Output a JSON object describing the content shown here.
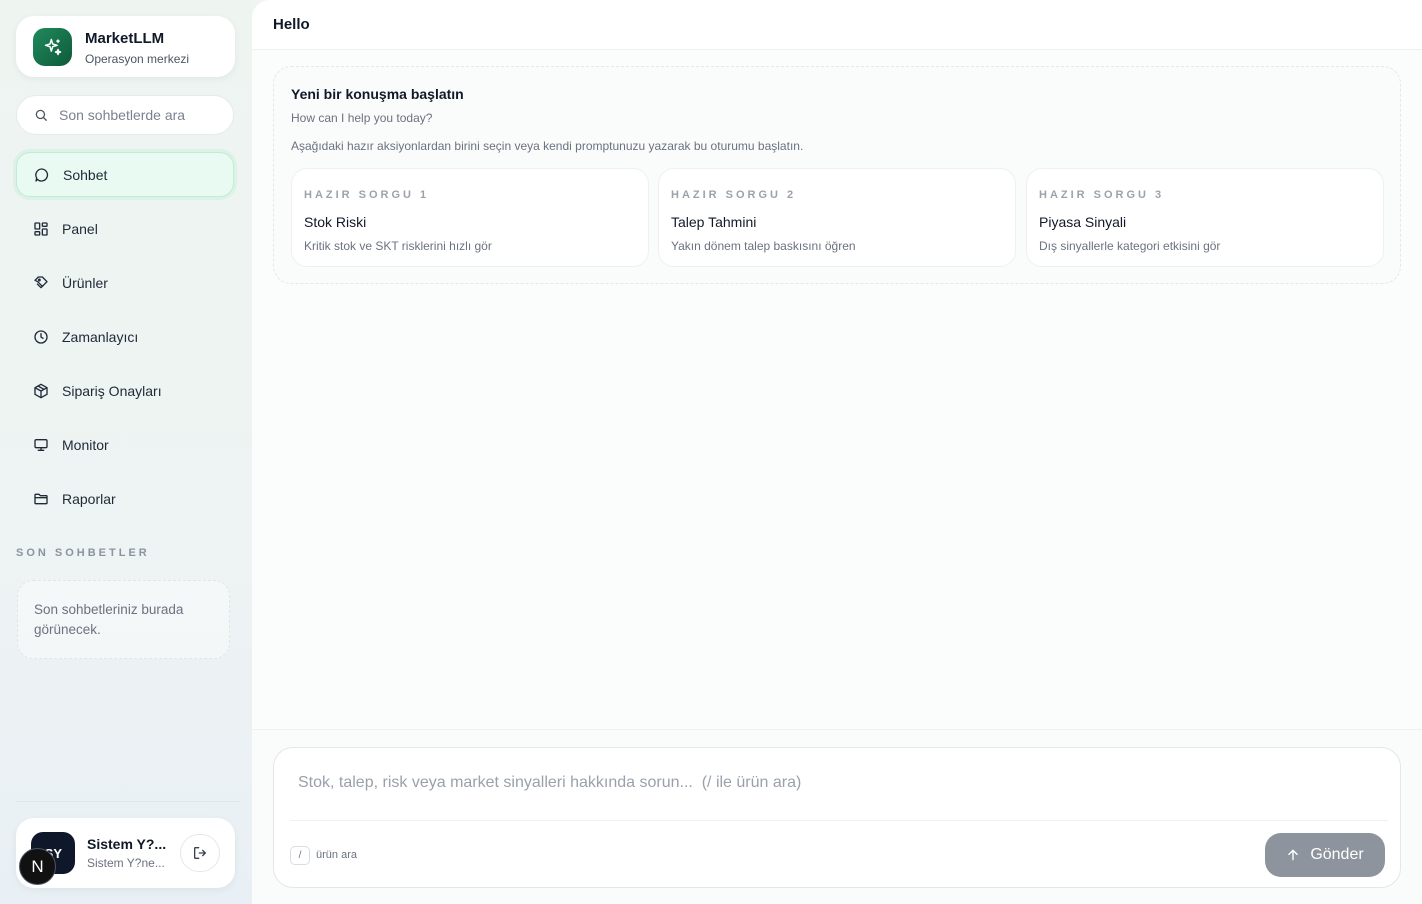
{
  "brand": {
    "name": "MarketLLM",
    "subtitle": "Operasyon merkezi",
    "logo_icon": "sparkles-icon",
    "accent": "#1f8a5c"
  },
  "search": {
    "placeholder": "Son sohbetlerde ara",
    "icon": "search-icon"
  },
  "nav": [
    {
      "label": "Sohbet",
      "icon": "chat-icon",
      "active": true
    },
    {
      "label": "Panel",
      "icon": "grid-icon",
      "active": false
    },
    {
      "label": "Ürünler",
      "icon": "tag-icon",
      "active": false
    },
    {
      "label": "Zamanlayıcı",
      "icon": "clock-icon",
      "active": false
    },
    {
      "label": "Sipariş Onayları",
      "icon": "package-icon",
      "active": false
    },
    {
      "label": "Monitor",
      "icon": "monitor-icon",
      "active": false
    },
    {
      "label": "Raporlar",
      "icon": "folder-icon",
      "active": false
    }
  ],
  "recent": {
    "title": "SON SOHBETLER",
    "empty_text": "Son sohbetleriniz burada görünecek."
  },
  "user": {
    "initials": "SY",
    "name": "Sistem Y?...",
    "subtitle": "Sistem Y?ne...",
    "logout_icon": "logout-icon",
    "badge_letter": "N"
  },
  "header": {
    "title": "Hello"
  },
  "welcome": {
    "title": "Yeni bir konuşma başlatın",
    "subtitle": "How can I help you today?",
    "description": "Aşağıdaki hazır aksiyonlardan birini seçin veya kendi promptunuzu yazarak bu oturumu başlatın.",
    "cards": [
      {
        "kicker": "HAZIR SORGU 1",
        "title": "Stok Riski",
        "desc": "Kritik stok ve SKT risklerini hızlı gör"
      },
      {
        "kicker": "HAZIR SORGU 2",
        "title": "Talep Tahmini",
        "desc": "Yakın dönem talep baskısını öğren"
      },
      {
        "kicker": "HAZIR SORGU 3",
        "title": "Piyasa Sinyali",
        "desc": "Dış sinyallerle kategori etkisini gör"
      }
    ]
  },
  "composer": {
    "placeholder": "Stok, talep, risk veya market sinyalleri hakkında sorun...  (/ ile ürün ara)",
    "slash_key": "/",
    "slash_hint": "ürün ara",
    "send_label": "Gönder",
    "send_icon": "arrow-up-icon",
    "send_color": "#8d949d"
  }
}
